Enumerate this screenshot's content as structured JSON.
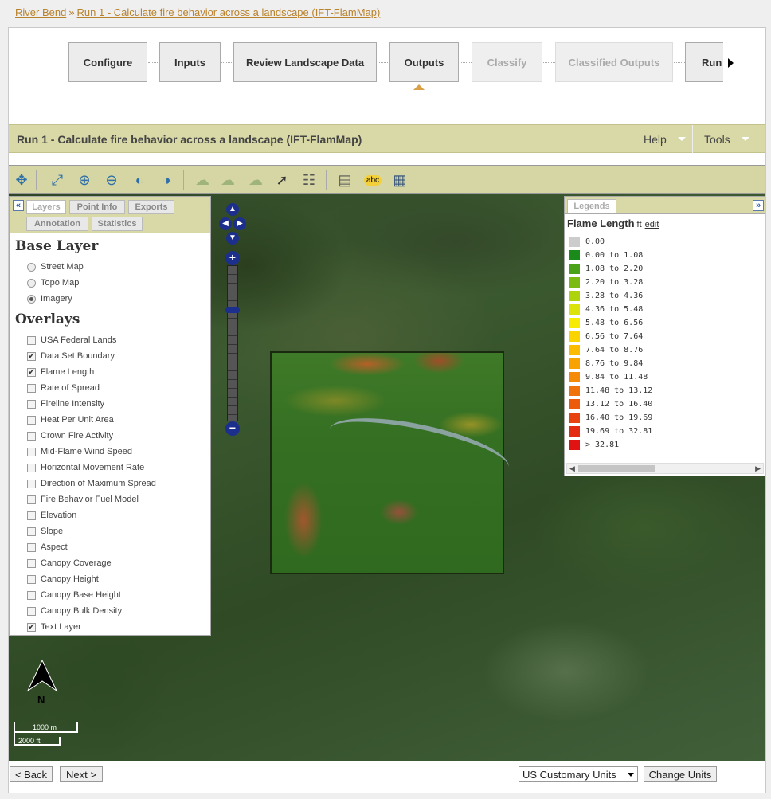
{
  "breadcrumb": {
    "project": "River Bend",
    "separator": "»",
    "run": "Run 1 - Calculate fire behavior across a landscape (IFT-FlamMap)"
  },
  "steps": [
    {
      "label": "Configure",
      "state": "done"
    },
    {
      "label": "Inputs",
      "state": "done"
    },
    {
      "label": "Review Landscape Data",
      "state": "done"
    },
    {
      "label": "Outputs",
      "state": "current"
    },
    {
      "label": "Classify",
      "state": "disabled"
    },
    {
      "label": "Classified Outputs",
      "state": "disabled"
    },
    {
      "label": "Run",
      "state": "done"
    }
  ],
  "titlebar": {
    "title": "Run 1 - Calculate fire behavior across a landscape (IFT-FlamMap)",
    "help": "Help",
    "tools": "Tools"
  },
  "toolbar_icons": [
    "pan-icon",
    "zoom-extent-icon",
    "zoom-in-icon",
    "zoom-out-icon",
    "zoom-previous-icon",
    "zoom-next-icon",
    "draw-polygon-icon",
    "edit-polygon-icon",
    "polygon-table-icon",
    "identify-icon",
    "attribute-table-icon",
    "export-icon",
    "label-icon",
    "layer-info-icon"
  ],
  "left_panel": {
    "tabs": [
      "Layers",
      "Point Info",
      "Exports",
      "Annotation",
      "Statistics"
    ],
    "base_layer_title": "Base Layer",
    "base_layers": [
      {
        "label": "Street Map",
        "selected": false
      },
      {
        "label": "Topo Map",
        "selected": false
      },
      {
        "label": "Imagery",
        "selected": true
      }
    ],
    "overlays_title": "Overlays",
    "overlays": [
      {
        "label": "USA Federal Lands",
        "checked": false
      },
      {
        "label": "Data Set Boundary",
        "checked": true
      },
      {
        "label": "Flame Length",
        "checked": true
      },
      {
        "label": "Rate of Spread",
        "checked": false
      },
      {
        "label": "Fireline Intensity",
        "checked": false
      },
      {
        "label": "Heat Per Unit Area",
        "checked": false
      },
      {
        "label": "Crown Fire Activity",
        "checked": false
      },
      {
        "label": "Mid-Flame Wind Speed",
        "checked": false
      },
      {
        "label": "Horizontal Movement Rate",
        "checked": false
      },
      {
        "label": "Direction of Maximum Spread",
        "checked": false
      },
      {
        "label": "Fire Behavior Fuel Model",
        "checked": false
      },
      {
        "label": "Elevation",
        "checked": false
      },
      {
        "label": "Slope",
        "checked": false
      },
      {
        "label": "Aspect",
        "checked": false
      },
      {
        "label": "Canopy Coverage",
        "checked": false
      },
      {
        "label": "Canopy Height",
        "checked": false
      },
      {
        "label": "Canopy Base Height",
        "checked": false
      },
      {
        "label": "Canopy Bulk Density",
        "checked": false
      },
      {
        "label": "Text Layer",
        "checked": true
      }
    ]
  },
  "legend": {
    "tab": "Legends",
    "title": "Flame Length",
    "unit": "ft",
    "edit": "edit",
    "entries": [
      {
        "label": "0.00",
        "color": "#cccccc"
      },
      {
        "label": "0.00 to 1.08",
        "color": "#1a8a1a"
      },
      {
        "label": "1.08 to 2.20",
        "color": "#4aa317"
      },
      {
        "label": "2.20 to 3.28",
        "color": "#7cbb12"
      },
      {
        "label": "3.28 to 4.36",
        "color": "#aed20c"
      },
      {
        "label": "4.36 to 5.48",
        "color": "#dbe308"
      },
      {
        "label": "5.48 to 6.56",
        "color": "#f7ea03"
      },
      {
        "label": "6.56 to 7.64",
        "color": "#fbd300"
      },
      {
        "label": "7.64 to 8.76",
        "color": "#fbbb00"
      },
      {
        "label": "8.76 to 9.84",
        "color": "#f8a300"
      },
      {
        "label": "9.84 to 11.48",
        "color": "#f48a06"
      },
      {
        "label": "11.48 to 13.12",
        "color": "#f0720a"
      },
      {
        "label": "13.12 to 16.40",
        "color": "#ec5a0c"
      },
      {
        "label": "16.40 to 19.69",
        "color": "#e8420e"
      },
      {
        "label": "19.69 to 32.81",
        "color": "#e42a10"
      },
      {
        "label": "> 32.81",
        "color": "#e01212"
      }
    ]
  },
  "map": {
    "north_label": "N",
    "scale_metric": "1000 m",
    "scale_imperial": "2000 ft"
  },
  "bottom": {
    "back": "< Back",
    "next": "Next >",
    "units_selected": "US Customary Units",
    "change_units": "Change Units"
  }
}
